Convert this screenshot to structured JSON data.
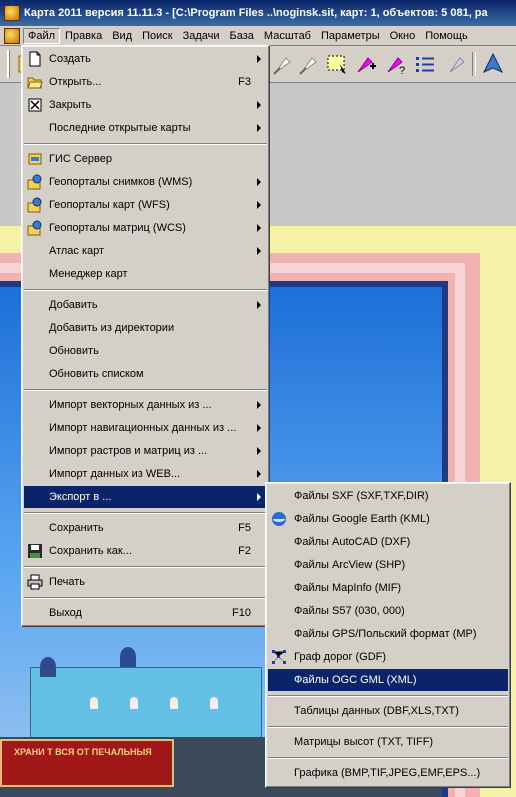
{
  "window": {
    "title": "Карта 2011 версия 11.11.3 - [C:\\Program Files ..\\noginsk.sit, карт: 1, объектов: 5 081, ра"
  },
  "menubar": {
    "items": [
      "Файл",
      "Правка",
      "Вид",
      "Поиск",
      "Задачи",
      "База",
      "Масштаб",
      "Параметры",
      "Окно",
      "Помощь"
    ]
  },
  "file_menu": {
    "items": [
      {
        "label": "Создать",
        "shortcut": "",
        "submenu": true,
        "icon": "new-doc-icon"
      },
      {
        "label": "Открыть...",
        "shortcut": "F3",
        "submenu": false,
        "icon": "open-folder-icon"
      },
      {
        "label": "Закрыть",
        "shortcut": "",
        "submenu": true,
        "icon": "close-box-icon"
      },
      {
        "label": "Последние открытые карты",
        "shortcut": "",
        "submenu": true,
        "icon": ""
      },
      {
        "label": "ГИС Сервер",
        "shortcut": "",
        "submenu": false,
        "icon": "gis-server-icon"
      },
      {
        "label": "Геопорталы снимков (WMS)",
        "shortcut": "",
        "submenu": true,
        "icon": "geoportal-icon"
      },
      {
        "label": "Геопорталы карт (WFS)",
        "shortcut": "",
        "submenu": true,
        "icon": "geoportal-icon"
      },
      {
        "label": "Геопорталы матриц (WCS)",
        "shortcut": "",
        "submenu": true,
        "icon": "geoportal-icon"
      },
      {
        "label": "Атлас карт",
        "shortcut": "",
        "submenu": true,
        "icon": ""
      },
      {
        "label": "Менеджер карт",
        "shortcut": "",
        "submenu": false,
        "icon": ""
      },
      {
        "label": "Добавить",
        "shortcut": "",
        "submenu": true,
        "icon": ""
      },
      {
        "label": "Добавить из директории",
        "shortcut": "",
        "submenu": false,
        "icon": ""
      },
      {
        "label": "Обновить",
        "shortcut": "",
        "submenu": false,
        "icon": ""
      },
      {
        "label": "Обновить списком",
        "shortcut": "",
        "submenu": false,
        "icon": ""
      },
      {
        "label": "Импорт векторных данных из ...",
        "shortcut": "",
        "submenu": true,
        "icon": ""
      },
      {
        "label": "Импорт навигационных данных из ...",
        "shortcut": "",
        "submenu": true,
        "icon": ""
      },
      {
        "label": "Импорт растров и матриц из ...",
        "shortcut": "",
        "submenu": true,
        "icon": ""
      },
      {
        "label": "Импорт данных из WEB...",
        "shortcut": "",
        "submenu": true,
        "icon": ""
      },
      {
        "label": "Экспорт в ...",
        "shortcut": "",
        "submenu": true,
        "icon": "",
        "highlighted": true
      },
      {
        "label": "Сохранить",
        "shortcut": "F5",
        "submenu": false,
        "icon": ""
      },
      {
        "label": "Сохранить как...",
        "shortcut": "F2",
        "submenu": false,
        "icon": "save-disk-icon"
      },
      {
        "label": "Печать",
        "shortcut": "",
        "submenu": false,
        "icon": "printer-icon"
      },
      {
        "label": "Выход",
        "shortcut": "F10",
        "submenu": false,
        "icon": ""
      }
    ]
  },
  "export_menu": {
    "items": [
      {
        "label": "Файлы SXF (SXF,TXF,DIR)",
        "icon": ""
      },
      {
        "label": "Файлы Google Earth (KML)",
        "icon": "google-earth-icon"
      },
      {
        "label": "Файлы AutoCAD (DXF)",
        "icon": ""
      },
      {
        "label": "Файлы ArcView (SHP)",
        "icon": ""
      },
      {
        "label": "Файлы MapInfo (MIF)",
        "icon": ""
      },
      {
        "label": "Файлы S57 (030, 000)",
        "icon": ""
      },
      {
        "label": "Файлы GPS/Польский формат (MP)",
        "icon": ""
      },
      {
        "label": "Граф дорог (GDF)",
        "icon": "road-graph-icon"
      },
      {
        "label": "Файлы OGC GML (XML)",
        "icon": "",
        "highlighted": true
      },
      {
        "label": "Таблицы данных (DBF,XLS,TXT)",
        "icon": ""
      },
      {
        "label": "Матрицы высот (TXT, TIFF)",
        "icon": ""
      },
      {
        "label": "Графика (BMP,TIF,JPEG,EMF,EPS...)",
        "icon": ""
      }
    ]
  },
  "photo": {
    "banner_text": "ХРАНИ Т ВСЯ ОТ ПЕЧАЛЬНЫЯ"
  },
  "colors": {
    "menu_bg": "#d4d0c8",
    "highlight": "#0a246a",
    "map_yellow": "#f5f2a8",
    "map_pink": "#f2b2b0",
    "map_sky": "#1d6fd8"
  }
}
